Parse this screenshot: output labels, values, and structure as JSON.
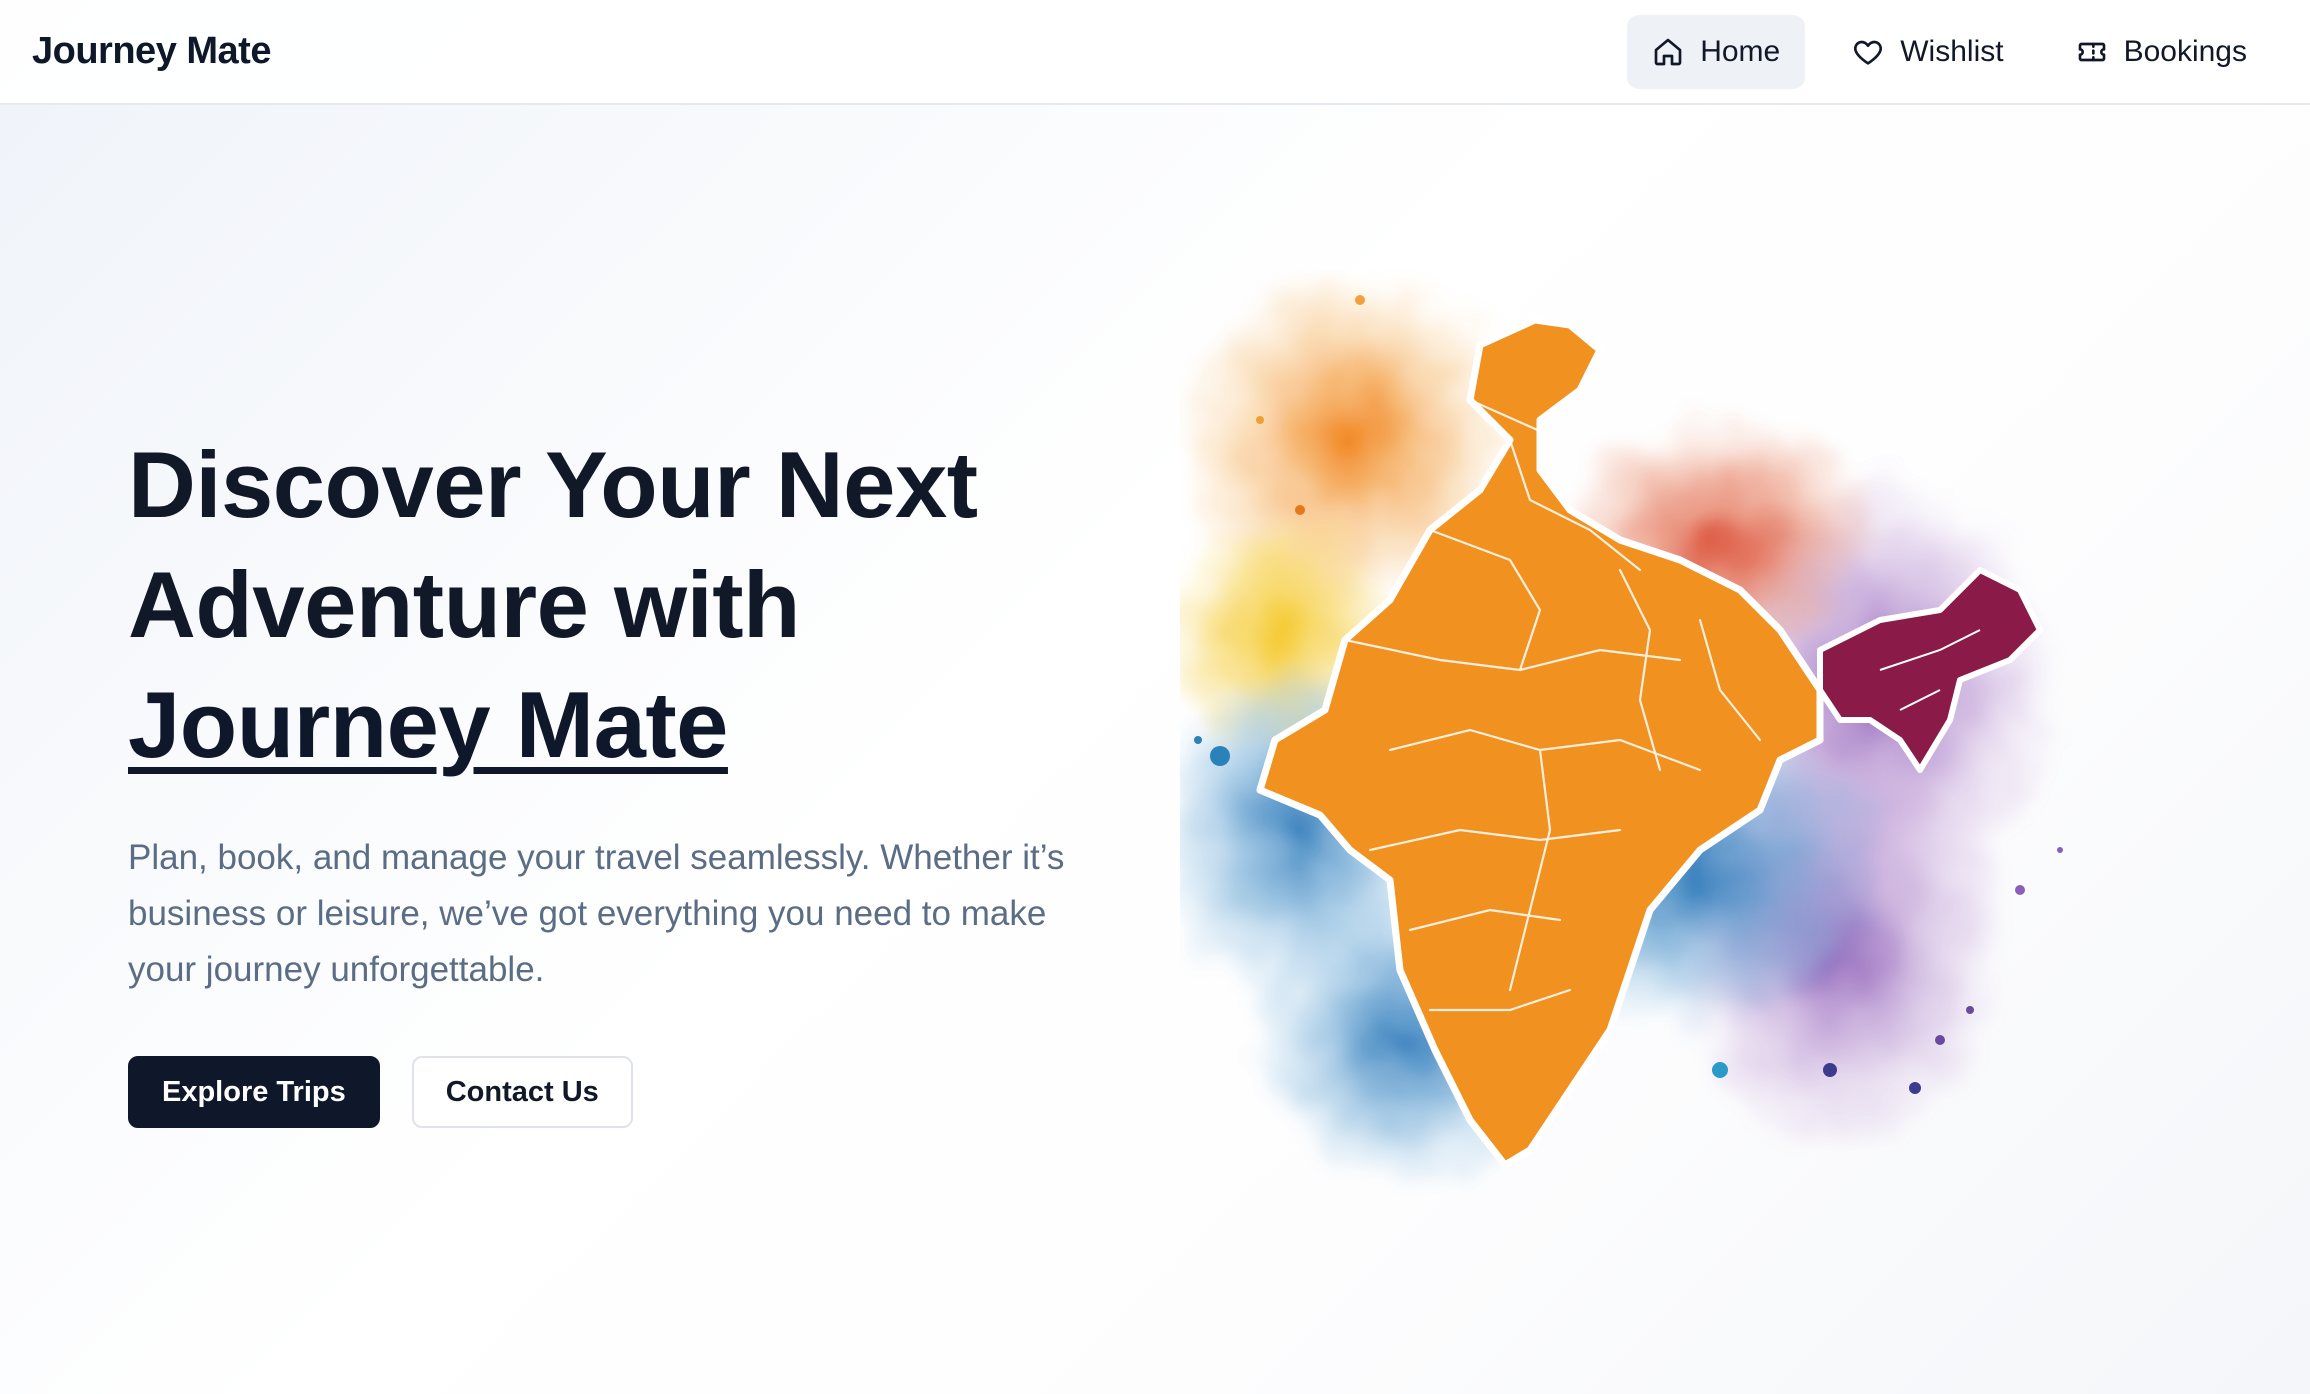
{
  "header": {
    "brand": "Journey Mate",
    "nav": [
      {
        "label": "Home",
        "icon": "home-icon",
        "active": true
      },
      {
        "label": "Wishlist",
        "icon": "heart-icon",
        "active": false
      },
      {
        "label": "Bookings",
        "icon": "ticket-icon",
        "active": false
      }
    ]
  },
  "hero": {
    "title_line1": "Discover Your Next",
    "title_line2": "Adventure with",
    "title_brand": "Journey Mate",
    "subtitle": "Plan, book, and manage your travel seamlessly. Whether it’s business or leisure, we’ve got everything you need to make your journey unforgettable.",
    "primary_button": "Explore Trips",
    "secondary_button": "Contact Us"
  },
  "illustration": {
    "name": "watercolor-india-map",
    "colors": [
      "#f08a1c",
      "#f3c21e",
      "#6aab2b",
      "#2e7fc0",
      "#9b5fb4",
      "#8a1438"
    ]
  },
  "colors": {
    "primary": "#0f172a",
    "text_muted": "#5b6d85",
    "nav_active_bg": "#eef1f6"
  }
}
